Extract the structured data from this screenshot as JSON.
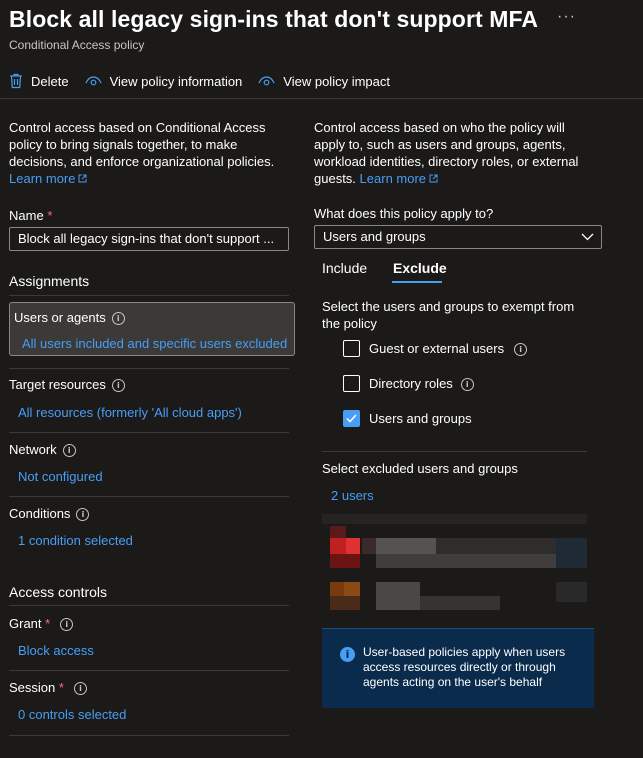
{
  "header": {
    "title": "Block all legacy sign-ins that don't support MFA",
    "subtitle": "Conditional Access policy",
    "more": "···"
  },
  "toolbar": {
    "delete_label": "Delete",
    "view_info_label": "View policy information",
    "view_impact_label": "View policy impact"
  },
  "left": {
    "description": "Control access based on Conditional Access policy to bring signals together, to make decisions, and enforce organizational policies.",
    "learn_more": "Learn more",
    "name_label": "Name",
    "name_required": "*",
    "name_value": "Block all legacy sign-ins that don't support ...",
    "assignments_heading": "Assignments",
    "users_label": "Users or agents",
    "users_value": "All users included and specific users excluded",
    "target_label": "Target resources",
    "target_value": "All resources (formerly 'All cloud apps')",
    "network_label": "Network",
    "network_value": "Not configured",
    "conditions_label": "Conditions",
    "conditions_value": "1 condition selected",
    "access_heading": "Access controls",
    "grant_label": "Grant",
    "grant_required": "*",
    "grant_value": "Block access",
    "session_label": "Session",
    "session_required": "*",
    "session_value": "0 controls selected"
  },
  "right": {
    "description": "Control access based on who the policy will apply to, such as users and groups, agents, workload identities, directory roles, or external guests.",
    "learn_more": "Learn more",
    "apply_question": "What does this policy apply to?",
    "apply_selected": "Users and groups",
    "tabs": {
      "include": "Include",
      "exclude": "Exclude"
    },
    "exclude_prompt": "Select the users and groups to exempt from the policy",
    "options": [
      {
        "label": "Guest or external users",
        "checked": false
      },
      {
        "label": "Directory roles",
        "checked": false
      },
      {
        "label": "Users and groups",
        "checked": true
      }
    ],
    "excluded_heading": "Select excluded users and groups",
    "excluded_count": "2 users",
    "info_text": "User-based policies apply when users access resources directly or through agents acting on the user's behalf"
  },
  "colors": {
    "background": "#1b1a19",
    "accent": "#479ef5",
    "required": "#f1707b",
    "info_box": "#0a2b4c"
  },
  "icons": [
    "trash-icon",
    "eye-icon",
    "external-link-icon",
    "info-icon",
    "chevron-down-icon",
    "checkmark-icon",
    "more-icon"
  ]
}
